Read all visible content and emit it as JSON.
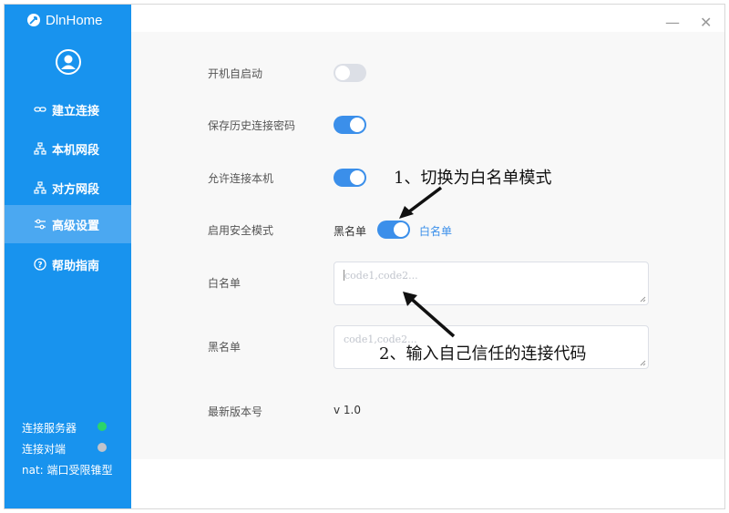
{
  "app": {
    "name": "DlnHome",
    "logo_icon": "rocket-icon",
    "accent": "#1893ee"
  },
  "window_controls": {
    "minimize": "—",
    "close": "✕"
  },
  "sidebar": {
    "avatar_icon": "user-circle-icon",
    "items": [
      {
        "label": "建立连接",
        "icon": "link-icon"
      },
      {
        "label": "本机网段",
        "icon": "network-icon"
      },
      {
        "label": "对方网段",
        "icon": "network-icon"
      },
      {
        "label": "高级设置",
        "icon": "sliders-icon",
        "active": true
      },
      {
        "label": "帮助指南",
        "icon": "help-circle-icon"
      }
    ],
    "status": [
      {
        "label": "连接服务器",
        "color": "#2bd46a"
      },
      {
        "label": "连接对端",
        "color": "#c0c4cc"
      },
      {
        "label": "nat: 端口受限锥型"
      }
    ]
  },
  "settings": {
    "autostart": {
      "label": "开机自启动",
      "on": false
    },
    "save_password": {
      "label": "保存历史连接密码",
      "on": true
    },
    "allow_local": {
      "label": "允许连接本机",
      "on": true
    },
    "safe_mode": {
      "label": "启用安全模式",
      "left_text": "黑名单",
      "right_text": "白名单",
      "on": true
    },
    "whitelist": {
      "label": "白名单",
      "placeholder": "code1,code2..."
    },
    "blacklist": {
      "label": "黑名单",
      "placeholder": "code1,code2..."
    },
    "version": {
      "label": "最新版本号",
      "value": "v 1.0"
    }
  },
  "annotations": {
    "step1": "1、切换为白名单模式",
    "step2": "2、输入自己信任的连接代码"
  }
}
